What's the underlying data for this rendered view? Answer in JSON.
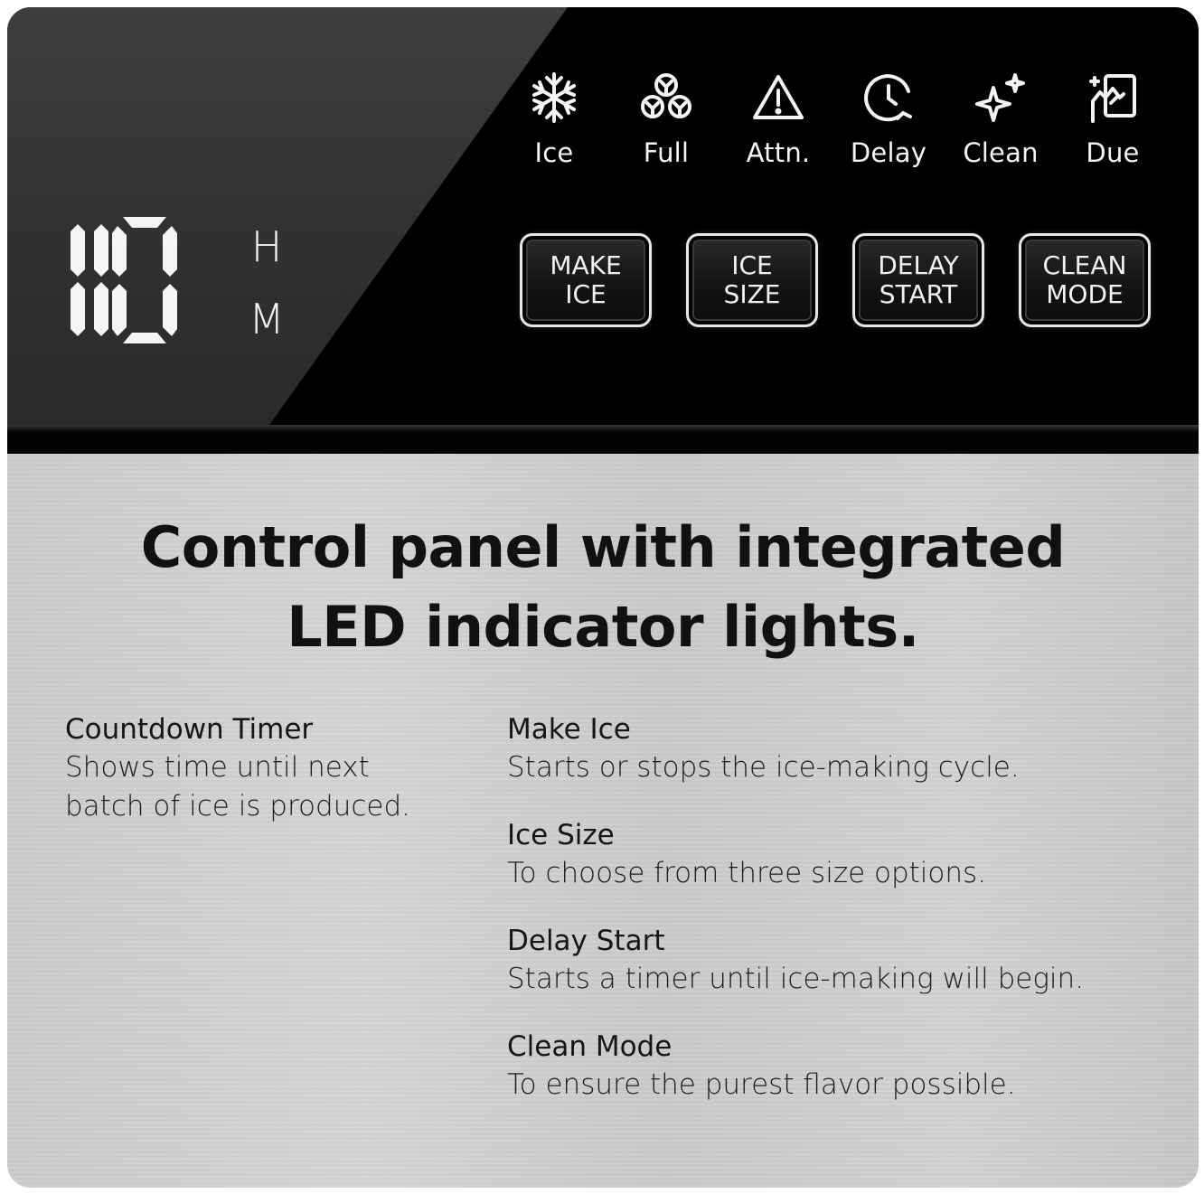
{
  "panel": {
    "display_digits": "10",
    "unit_h": "H",
    "unit_m": "M",
    "indicators": [
      {
        "icon": "snowflake-icon",
        "label": "Ice"
      },
      {
        "icon": "ice-cubes-icon",
        "label": "Full"
      },
      {
        "icon": "warning-triangle-icon",
        "label": "Attn."
      },
      {
        "icon": "clock-delay-icon",
        "label": "Delay"
      },
      {
        "icon": "sparkle-icon",
        "label": "Clean"
      },
      {
        "icon": "hand-clean-icon",
        "label": "Due"
      }
    ],
    "buttons": [
      {
        "label": "MAKE\nICE"
      },
      {
        "label": "ICE\nSIZE"
      },
      {
        "label": "DELAY\nSTART"
      },
      {
        "label": "CLEAN\nMODE"
      }
    ]
  },
  "headline": "Control panel with integrated\nLED indicator lights.",
  "features_left": [
    {
      "title": "Countdown Timer",
      "text": "Shows time until next batch of ice is produced."
    }
  ],
  "features_right": [
    {
      "title": "Make Ice",
      "text": "Starts or stops the ice-making cycle."
    },
    {
      "title": "Ice Size",
      "text": "To choose from three size options."
    },
    {
      "title": "Delay Start",
      "text": "Starts a timer until ice-making will begin."
    },
    {
      "title": "Clean Mode",
      "text": "To ensure the purest flavor possible."
    }
  ],
  "colors": {
    "panel": "#000000",
    "led": "#f5f5f5",
    "steel": "#cfcfcf",
    "text": "#111111"
  }
}
